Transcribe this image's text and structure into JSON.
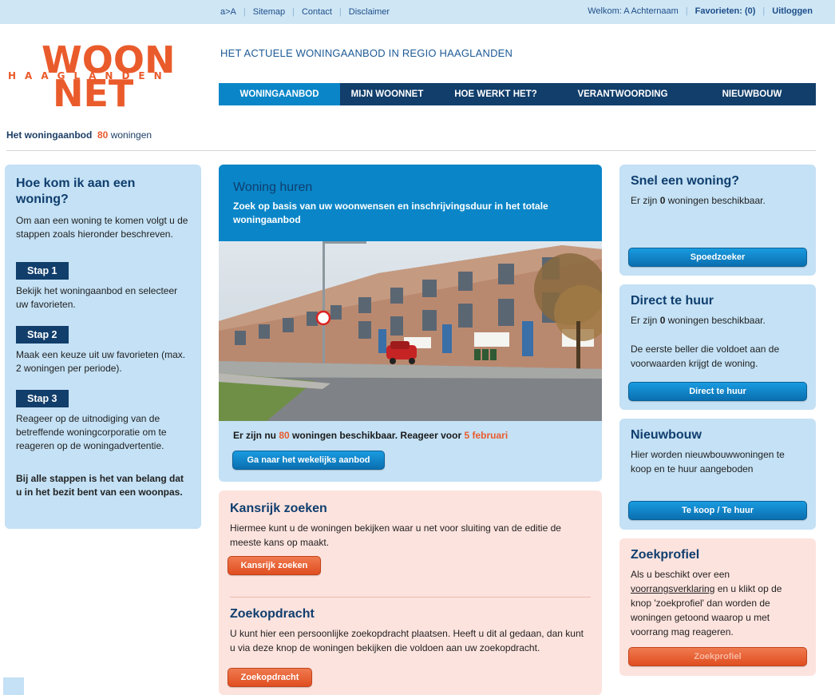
{
  "topbar": {
    "links": [
      "a>A",
      "Sitemap",
      "Contact",
      "Disclaimer"
    ],
    "welcome": "Welkom: A Achternaam",
    "favorites": "Favorieten: (0)",
    "logout": "Uitloggen"
  },
  "logo": {
    "line1": "WOON",
    "line2": "HAAGLANDEN",
    "line3": "NET"
  },
  "tagline": "HET ACTUELE WONINGAANBOD IN REGIO HAAGLANDEN",
  "nav": [
    "WONINGAANBOD",
    "MIJN WOONNET",
    "HOE WERKT HET?",
    "VERANTWOORDING",
    "NIEUWBOUW"
  ],
  "breadcrumb": {
    "label": "Het woningaanbod",
    "count": "80",
    "suffix": "woningen"
  },
  "left": {
    "title": "Hoe kom ik aan een woning?",
    "intro": "Om aan een woning te komen volgt u de stappen zoals hieronder beschreven.",
    "steps": [
      {
        "label": "Stap 1",
        "text": "Bekijk het woningaanbod en selecteer uw favorieten."
      },
      {
        "label": "Stap 2",
        "text": "Maak een keuze uit uw favorieten (max. 2 woningen per periode)."
      },
      {
        "label": "Stap 3",
        "text": "Reageer op de uitnodiging van de betreffende woningcorporatie om te reageren op de woningadvertentie."
      }
    ],
    "note": "Bij alle stappen is het van belang dat u in het bezit bent van een woonpas."
  },
  "hero": {
    "title": "Woning huren",
    "subtitle": "Zoek op basis van uw woonwensen en inschrijvingsduur in het totale woningaanbod",
    "avail_pre": "Er zijn nu",
    "avail_count": "80",
    "avail_mid": "woningen beschikbaar. Reageer voor",
    "avail_date": "5 februari",
    "button": "Ga naar het wekelijks aanbod"
  },
  "kansrijk": {
    "title": "Kansrijk zoeken",
    "text": "Hiermee kunt u de woningen bekijken waar u net voor sluiting van de editie de meeste kans op maakt.",
    "button": "Kansrijk zoeken"
  },
  "zoekopdracht": {
    "title": "Zoekopdracht",
    "text": "U kunt hier een persoonlijke zoekopdracht plaatsen. Heeft u dit al gedaan, dan kunt u via deze knop de woningen bekijken die voldoen aan uw zoekopdracht.",
    "button": "Zoekopdracht"
  },
  "snel": {
    "title": "Snel een woning?",
    "pre": "Er zijn",
    "count": "0",
    "post": "woningen beschikbaar.",
    "button": "Spoedzoeker"
  },
  "direct": {
    "title": "Direct te huur",
    "pre": "Er zijn",
    "count": "0",
    "post": "woningen beschikbaar.",
    "text": "De eerste beller die voldoet aan de voorwaarden krijgt de woning.",
    "button": "Direct te huur"
  },
  "nieuwbouw": {
    "title": "Nieuwbouw",
    "text": "Hier worden nieuwbouwwoningen te koop en te huur aangeboden",
    "button": "Te koop / Te huur"
  },
  "zoekprofiel": {
    "title": "Zoekprofiel",
    "pre": "Als u beschikt over een",
    "link": "voorrangsverklaring",
    "post": "en u klikt op de knop 'zoekprofiel' dan worden de woningen getoond waarop u met voorrang mag reageren.",
    "button": "Zoekprofiel"
  }
}
